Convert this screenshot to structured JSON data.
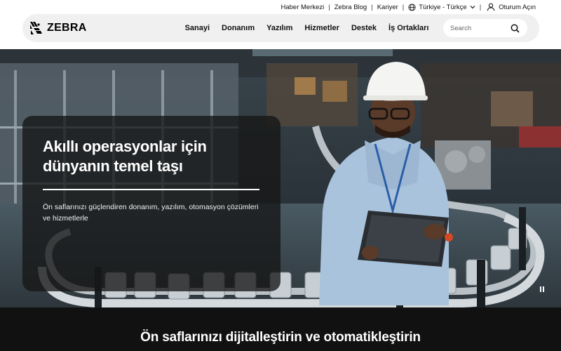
{
  "utility": {
    "links": [
      "Haber Merkezi",
      "Zebra Blog",
      "Kariyer"
    ],
    "locale": "Türkiye - Türkçe",
    "login": "Oturum Açın"
  },
  "nav": {
    "logo": "ZEBRA",
    "items": [
      "Sanayi",
      "Donanım",
      "Yazılım",
      "Hizmetler",
      "Destek",
      "İş Ortakları"
    ],
    "search_placeholder": "Search"
  },
  "hero": {
    "title": "Akıllı operasyonlar için dünyanın temel taşı",
    "subtitle": "Ön saflarınızı güçlendiren donanım, yazılım, otomasyon çözümleri ve hizmetlerle"
  },
  "band": {
    "title": "Ön saflarınızı dijitalleştirin ve otomatikleştirin"
  },
  "colors": {
    "nav_bg": "#f0f0f0",
    "hero_card_bg": "#161616",
    "band_bg": "#111111"
  }
}
